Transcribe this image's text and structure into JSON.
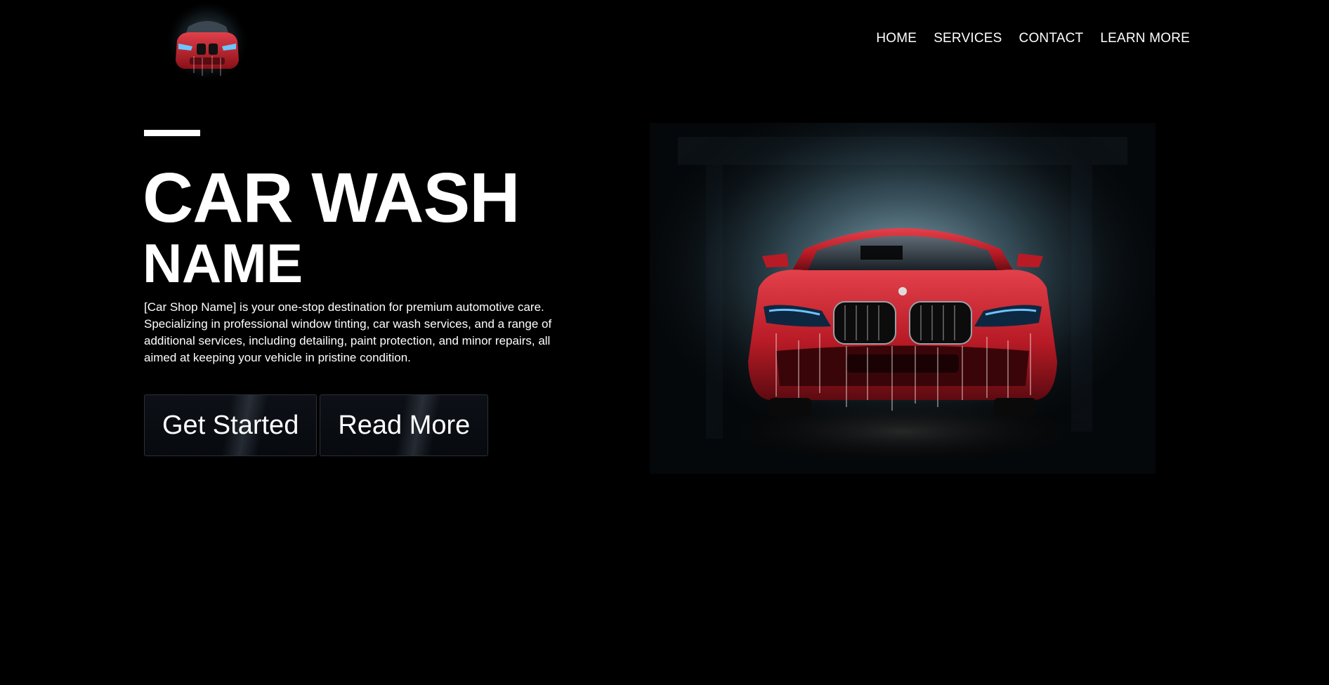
{
  "header": {
    "logo_icon": "red-car-logo",
    "nav": [
      {
        "label": "HOME"
      },
      {
        "label": "SERVICES"
      },
      {
        "label": "CONTACT"
      },
      {
        "label": "LEARN MORE"
      }
    ]
  },
  "hero": {
    "title_line1": "CAR WASH",
    "title_line2": "NAME",
    "description": "[Car Shop Name] is your one-stop destination for premium automotive care. Specializing in professional window tinting, car wash services, and a range of additional services, including detailing, paint protection, and minor repairs, all aimed at keeping your vehicle in pristine condition.",
    "buttons": {
      "primary": "Get Started",
      "secondary": "Read More"
    },
    "image_icon": "red-car-in-wash-image"
  },
  "colors": {
    "background": "#000000",
    "text": "#ffffff",
    "car_red": "#c0202a",
    "headlight_blue": "#3fa9ff"
  }
}
